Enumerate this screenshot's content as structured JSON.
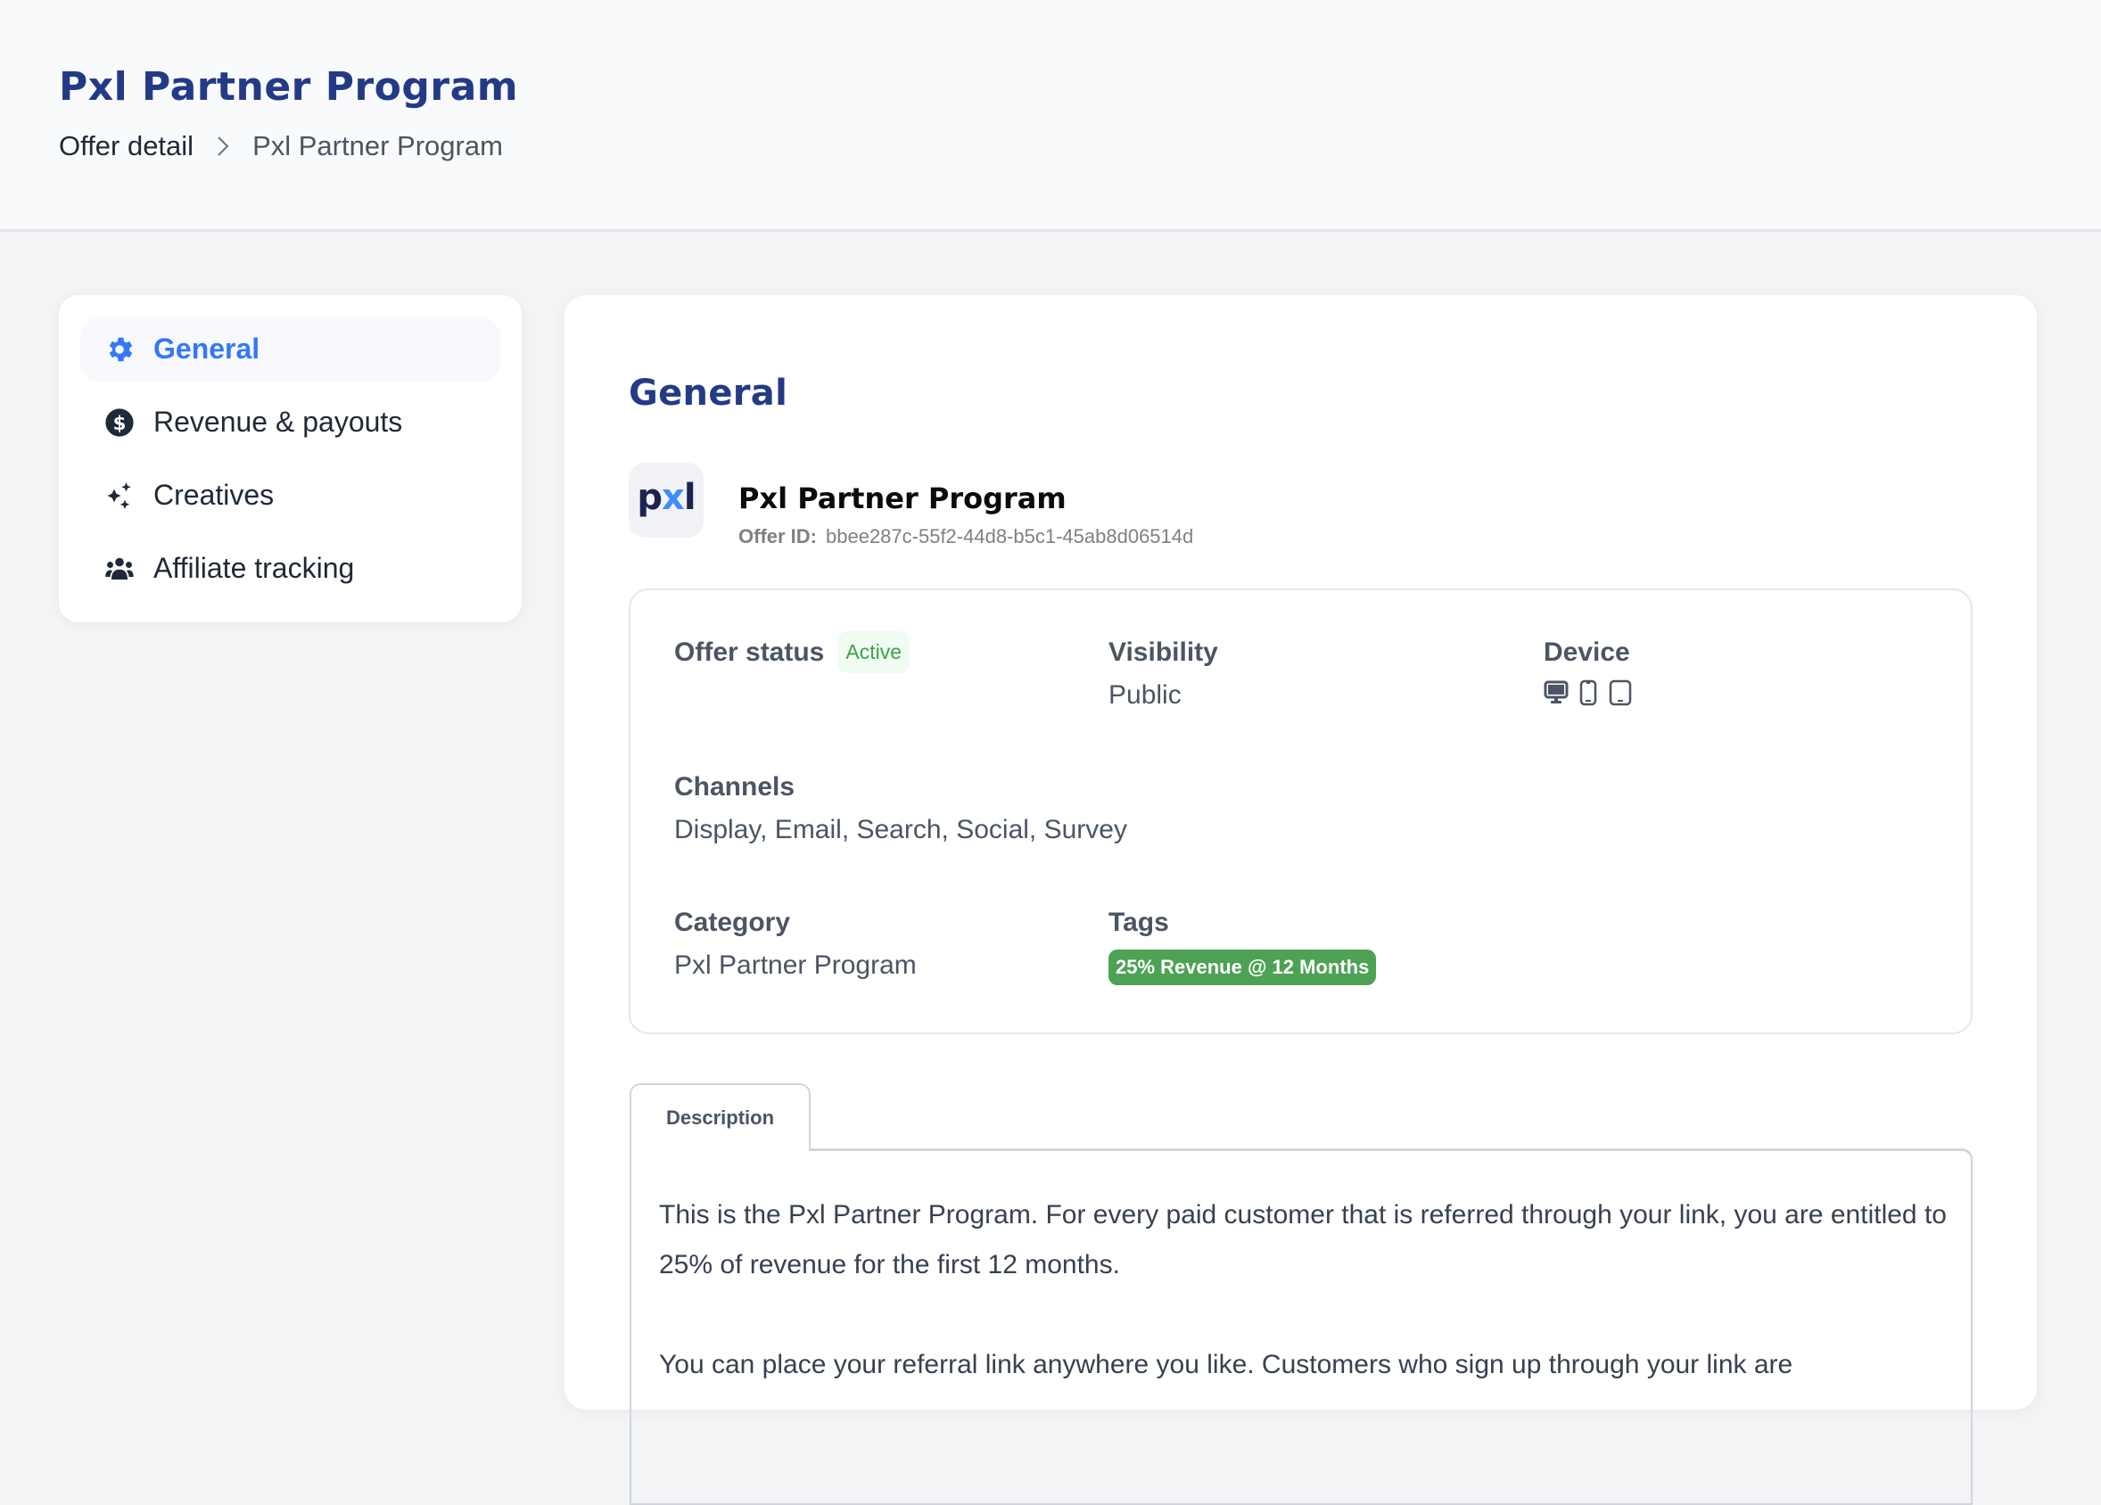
{
  "header": {
    "title": "Pxl Partner Program",
    "breadcrumb": [
      {
        "label": "Offer detail"
      },
      {
        "label": "Pxl Partner Program"
      }
    ],
    "breadcrumb_separator_icon": "chevron-right-icon"
  },
  "sidebar": {
    "items": [
      {
        "label": "General",
        "icon": "gear-icon",
        "active": true
      },
      {
        "label": "Revenue & payouts",
        "icon": "dollar-circle-icon",
        "active": false
      },
      {
        "label": "Creatives",
        "icon": "sparkles-icon",
        "active": false
      },
      {
        "label": "Affiliate tracking",
        "icon": "users-icon",
        "active": false
      }
    ]
  },
  "main": {
    "section_title": "General",
    "offer": {
      "logo_text": {
        "p": "p",
        "x": "x",
        "l": "l"
      },
      "name": "Pxl Partner Program",
      "id_label": "Offer ID:",
      "id_value": "bbee287c-55f2-44d8-b5c1-45ab8d06514d"
    },
    "details": {
      "offer_status": {
        "label": "Offer status",
        "value": "Active"
      },
      "visibility": {
        "label": "Visibility",
        "value": "Public"
      },
      "device": {
        "label": "Device",
        "icons": [
          "desktop-icon",
          "mobile-icon",
          "tablet-icon"
        ]
      },
      "channels": {
        "label": "Channels",
        "value": "Display, Email, Search, Social, Survey"
      },
      "category": {
        "label": "Category",
        "value": "Pxl Partner Program"
      },
      "tags": {
        "label": "Tags",
        "values": [
          "25% Revenue @ 12 Months"
        ]
      }
    },
    "tabs": [
      {
        "label": "Description",
        "active": true
      }
    ],
    "description": [
      "This is the Pxl Partner Program. For every paid customer that is referred through your link, you are entitled to 25% of revenue for the first 12 months.",
      "You can place your referral link anywhere you like. Customers who sign up through your link are"
    ]
  },
  "colors": {
    "brand_navy": "#233a86",
    "accent_blue": "#3478f6",
    "status_green": "#3ea14b",
    "tag_green": "#4da254"
  }
}
